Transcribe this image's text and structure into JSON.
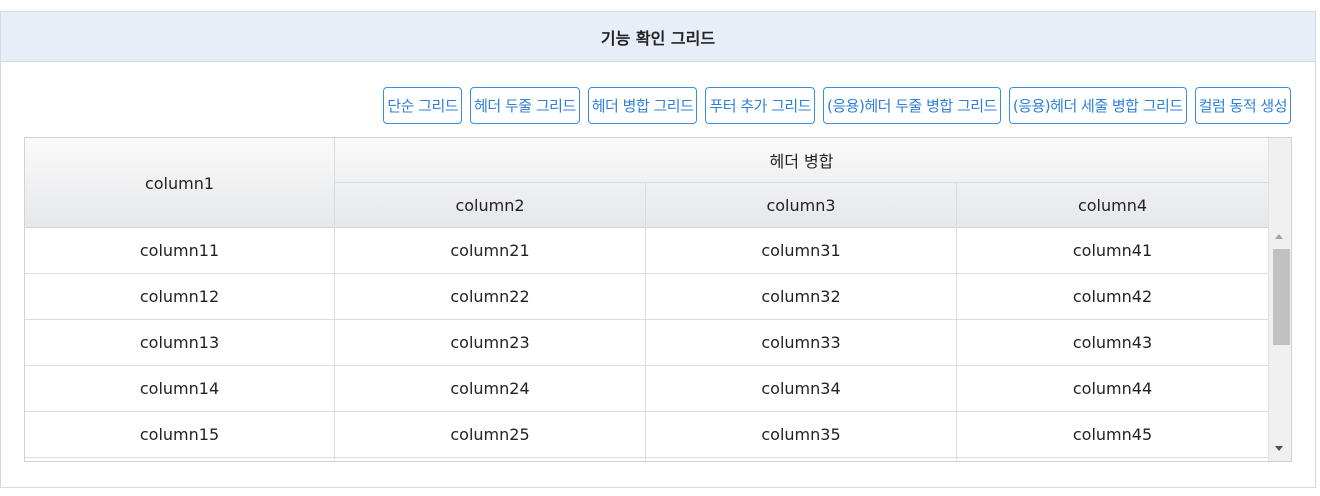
{
  "panel": {
    "title": "기능 확인 그리드"
  },
  "toolbar": {
    "buttons": [
      "단순 그리드",
      "헤더 두줄 그리드",
      "헤더 병합 그리드",
      "푸터 추가 그리드",
      "(응용)헤더 두줄 병합 그리드",
      "(응용)헤더 세줄 병합 그리드",
      "컬럼 동적 생성"
    ]
  },
  "grid": {
    "headers": {
      "col1": "column1",
      "merged": "헤더 병합",
      "col2": "column2",
      "col3": "column3",
      "col4": "column4"
    },
    "rows": [
      [
        "column11",
        "column21",
        "column31",
        "column41"
      ],
      [
        "column12",
        "column22",
        "column32",
        "column42"
      ],
      [
        "column13",
        "column23",
        "column33",
        "column43"
      ],
      [
        "column14",
        "column24",
        "column34",
        "column44"
      ],
      [
        "column15",
        "column25",
        "column35",
        "column45"
      ]
    ]
  },
  "colors": {
    "accent": "#2d7fd8",
    "header_bg": "#e8eef8"
  }
}
